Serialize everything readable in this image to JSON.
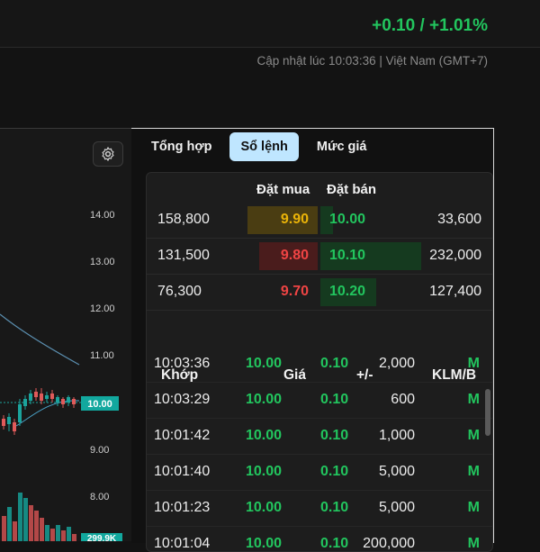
{
  "header": {
    "change": "+0.10 / +1.01%",
    "updated": "Cập nhật lúc 10:03:36 | Việt Nam (GMT+7)"
  },
  "chart": {
    "settings_icon": "gear-icon",
    "y_labels": [
      "14.00",
      "13.00",
      "12.00",
      "11.00",
      "10.00",
      "9.00",
      "8.00"
    ],
    "last_price": "10.00",
    "volume_tag": "299.9K"
  },
  "tabs": [
    {
      "label": "Tổng hợp"
    },
    {
      "label": "Sổ lệnh"
    },
    {
      "label": "Mức giá"
    }
  ],
  "order_book": {
    "bid_header": "Đặt mua",
    "ask_header": "Đặt bán",
    "rows": [
      {
        "bid_vol": "158,800",
        "bid_price": "9.90",
        "ask_price": "10.00",
        "ask_vol": "33,600"
      },
      {
        "bid_vol": "131,500",
        "bid_price": "9.80",
        "ask_price": "10.10",
        "ask_vol": "232,000"
      },
      {
        "bid_vol": "76,300",
        "bid_price": "9.70",
        "ask_price": "10.20",
        "ask_vol": "127,400"
      }
    ]
  },
  "matches": {
    "headers": {
      "time": "Khớp",
      "price": "Giá",
      "change": "+/-",
      "vol": "KLM/B"
    },
    "rows": [
      {
        "time": "10:03:36",
        "price": "10.00",
        "change": "0.10",
        "vol": "2,000",
        "side": "M"
      },
      {
        "time": "10:03:29",
        "price": "10.00",
        "change": "0.10",
        "vol": "600",
        "side": "M"
      },
      {
        "time": "10:01:42",
        "price": "10.00",
        "change": "0.10",
        "vol": "1,000",
        "side": "M"
      },
      {
        "time": "10:01:40",
        "price": "10.00",
        "change": "0.10",
        "vol": "5,000",
        "side": "M"
      },
      {
        "time": "10:01:23",
        "price": "10.00",
        "change": "0.10",
        "vol": "5,000",
        "side": "M"
      },
      {
        "time": "10:01:04",
        "price": "10.00",
        "change": "0.10",
        "vol": "200,000",
        "side": "M"
      }
    ]
  },
  "colors": {
    "up": "#22c55e",
    "down": "#ef4444",
    "ref": "#eab308",
    "accent": "#bfe6ff"
  }
}
